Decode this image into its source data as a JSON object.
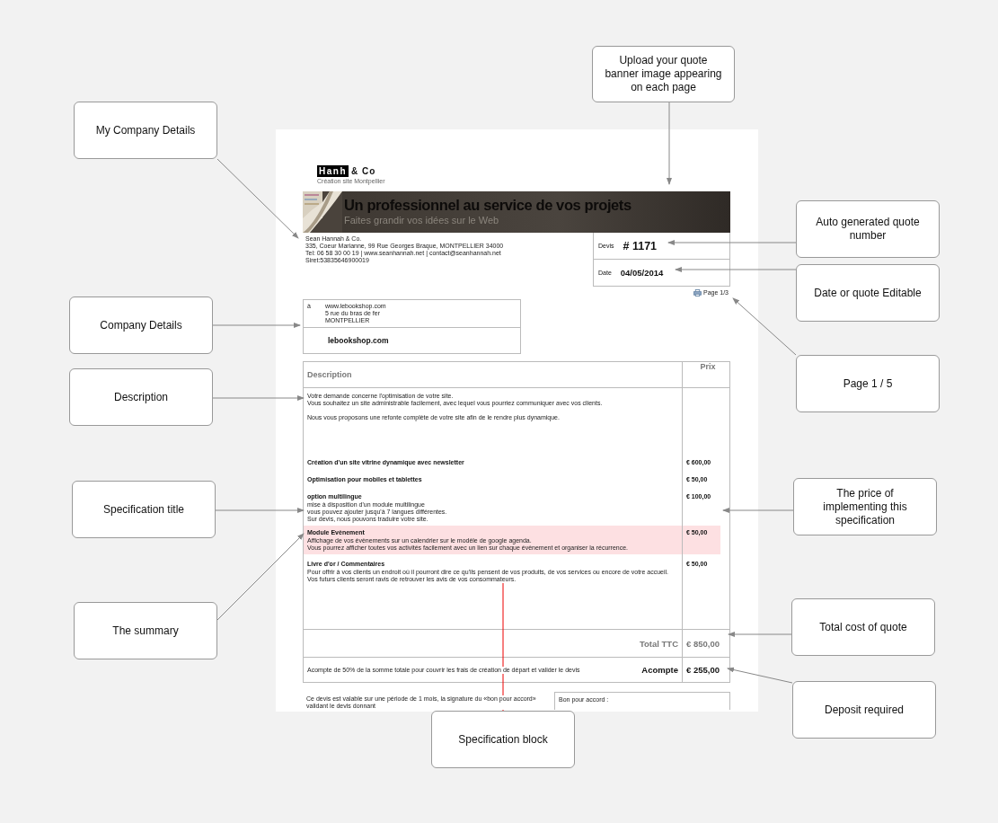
{
  "callouts": [
    {
      "text": "My Company Details"
    },
    {
      "text": "Upload your quote banner image appearing on each page"
    },
    {
      "text": "Auto generated quote number"
    },
    {
      "text": "Date or quote Editable"
    },
    {
      "text": "Company Details"
    },
    {
      "text": "Page 1 / 5"
    },
    {
      "text": "Description"
    },
    {
      "text": "Specification title"
    },
    {
      "text": "The price of implementing this specification"
    },
    {
      "text": "The summary"
    },
    {
      "text": "Total cost of quote"
    },
    {
      "text": "Deposit required"
    },
    {
      "text": "Specification block"
    }
  ],
  "document": {
    "logo": {
      "mark": "Hanh",
      "rest": "& Co",
      "tagline": "Création site Montpellier"
    },
    "banner": {
      "title": "Un professionnel au service de vos projets",
      "subtitle": "Faites grandir vos idées sur le Web"
    },
    "sender": [
      "Sean Hannah & Co.",
      "335, Coeur Marianne, 99 Rue Georges Braque, MONTPELLIER 34000",
      "Tel: 06 58 30 00 19  |  www.seanhannah.net  |  contact@seanhannah.net",
      "Siret:53835646900019"
    ],
    "quote_number": {
      "label": "Devis",
      "value": "# 1171"
    },
    "date": {
      "label": "Date",
      "value": "04/05/2014"
    },
    "page": "Page 1/3",
    "client": {
      "prefix": "à",
      "lines": [
        "www.lebookshop.com",
        "5 rue du bras de fer",
        "MONTPELLIER"
      ],
      "name": "lebookshop.com"
    },
    "table": {
      "columns": [
        "Description",
        "Prix"
      ],
      "intro": [
        "Votre demande concerne l'optimisation de votre site.",
        "Vous souhaitez un site administrable facilement, avec lequel vous pourriez communiquer avec vos clients.",
        "Nous vous proposons une refonte complète de votre site afin de le rendre plus dynamique."
      ],
      "items": [
        {
          "title": "Création d'un site vitrine dynamique avec newsletter",
          "price": "€ 600,00",
          "highlighted": false
        },
        {
          "title": "Optimisation pour mobiles et tablettes",
          "price": "€ 50,00",
          "highlighted": false
        },
        {
          "title": "option multilingue",
          "price": "€ 100,00",
          "highlighted": false,
          "lines": [
            "mise à disposition d'un module multilingue",
            "vous pouvez ajouter jusqu'à 7 langues différentes.",
            "Sur devis, nous pouvons traduire votre site."
          ]
        },
        {
          "title": "Module Evènement",
          "price": "€ 50,00",
          "highlighted": true,
          "lines": [
            "Affichage de vos évènements sur un calendrier sur le modèle de google agenda.",
            "Vous pourrez afficher toutes vos activités facilement avec un lien sur chaque évènement et organiser la récurrence."
          ]
        },
        {
          "title": "Livre d'or / Commentaires",
          "price": "€ 50,00",
          "highlighted": false,
          "lines": [
            "Pour offrir à vos clients un endroit où il pourront dire ce qu'ils pensent de vos produits, de vos services ou encore de votre accueil.",
            "Vos futurs clients seront ravis de retrouver les avis de vos consommateurs."
          ]
        }
      ],
      "total": {
        "label": "Total TTC",
        "value": "€ 850,00"
      },
      "deposit": {
        "note": "Acompte de 50% de la somme totale pour couvrir les frais de création de départ et valider le devis",
        "label": "Acompte",
        "value": "€ 255,00"
      }
    },
    "footer": {
      "note": "Ce devis est valable sur une période de 1 mois, la signature du «bon pour accord» validant le devis donnant",
      "approval": "Bon pour accord :"
    }
  }
}
